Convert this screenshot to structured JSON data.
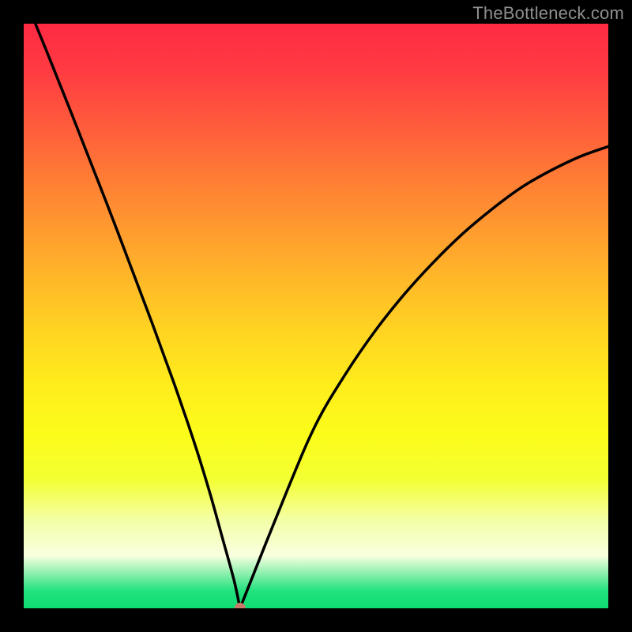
{
  "watermark": "TheBottleneck.com",
  "chart_data": {
    "type": "line",
    "title": "",
    "xlabel": "",
    "ylabel": "",
    "xlim": [
      0,
      100
    ],
    "ylim": [
      0,
      100
    ],
    "grid": false,
    "legend": false,
    "background_gradient_stops": [
      {
        "offset": 0.0,
        "color": "#ff2a44"
      },
      {
        "offset": 0.08,
        "color": "#ff3b42"
      },
      {
        "offset": 0.17,
        "color": "#ff5a3c"
      },
      {
        "offset": 0.26,
        "color": "#ff7b35"
      },
      {
        "offset": 0.35,
        "color": "#ff9a2f"
      },
      {
        "offset": 0.44,
        "color": "#ffb928"
      },
      {
        "offset": 0.53,
        "color": "#ffd522"
      },
      {
        "offset": 0.62,
        "color": "#ffed1c"
      },
      {
        "offset": 0.7,
        "color": "#fcfc1a"
      },
      {
        "offset": 0.78,
        "color": "#f3ff33"
      },
      {
        "offset": 0.85,
        "color": "#f4ffa8"
      },
      {
        "offset": 0.91,
        "color": "#f8ffdf"
      },
      {
        "offset": 0.97,
        "color": "#23e27e"
      },
      {
        "offset": 1.0,
        "color": "#0fdc73"
      }
    ],
    "series": [
      {
        "name": "bottleneck-curve",
        "color": "#000000",
        "stroke_width": 3.5,
        "x": [
          2,
          4,
          6,
          8,
          10,
          12,
          14,
          16,
          18,
          20,
          22,
          24,
          26,
          28,
          30,
          32,
          34,
          36,
          37,
          45,
          50,
          55,
          60,
          65,
          70,
          75,
          80,
          85,
          90,
          95,
          100
        ],
        "y": [
          100,
          95.1,
          90.1,
          85.1,
          80.0,
          74.9,
          69.8,
          64.6,
          59.3,
          54.0,
          48.7,
          43.2,
          37.7,
          31.9,
          25.8,
          19.2,
          12.0,
          4.7,
          0.0,
          20.0,
          31.5,
          40.0,
          47.3,
          53.6,
          59.1,
          64.0,
          68.2,
          71.9,
          74.8,
          77.2,
          79.0
        ]
      }
    ],
    "marker": {
      "name": "optimal-point",
      "x": 37,
      "y": 0,
      "color": "#c97b6b",
      "radius": 7
    }
  }
}
